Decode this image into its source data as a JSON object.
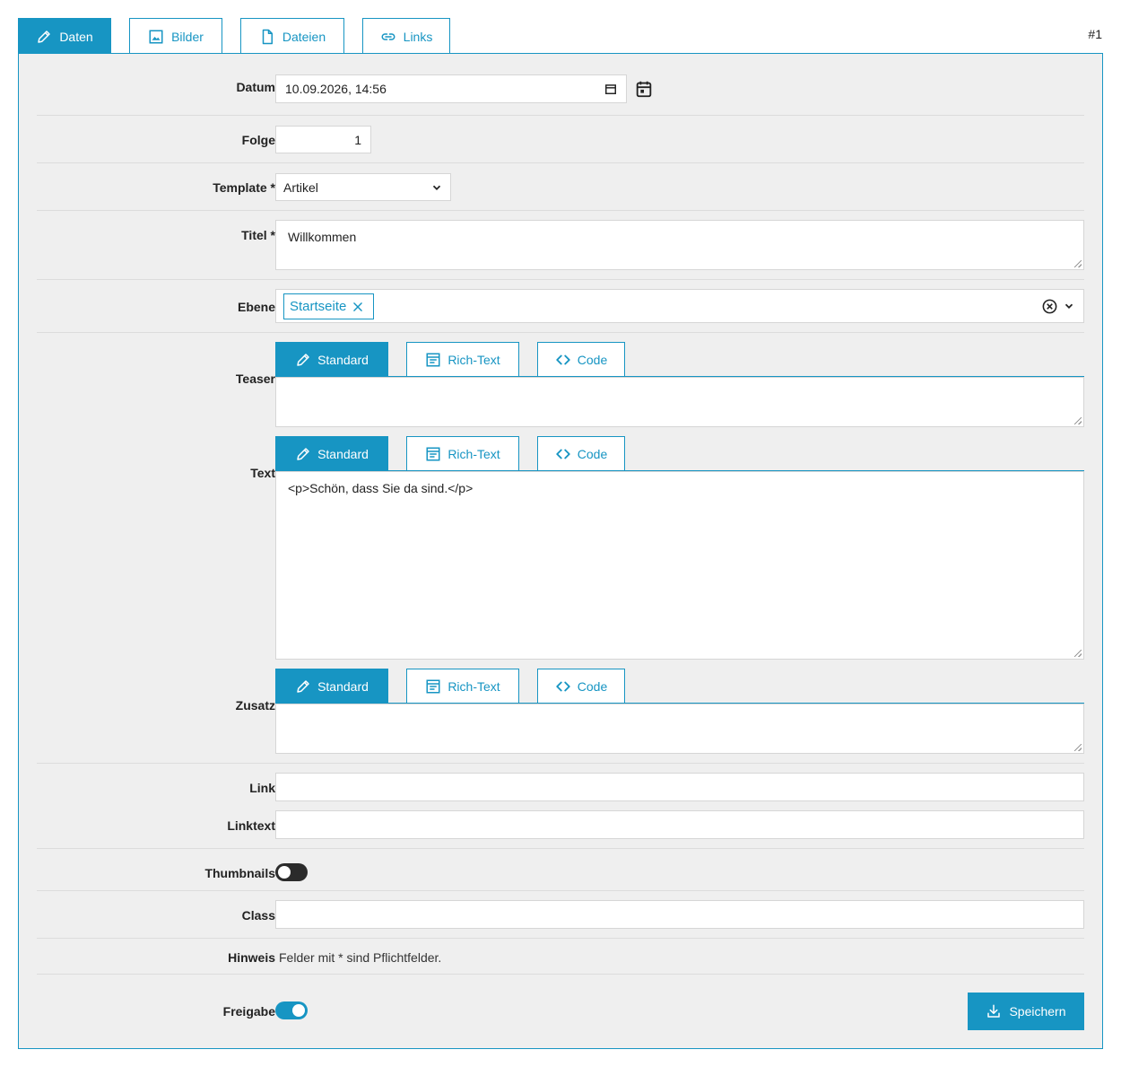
{
  "top_tabs": [
    {
      "label": "Daten",
      "icon": "pencil-icon",
      "active": true
    },
    {
      "label": "Bilder",
      "icon": "image-icon",
      "active": false
    },
    {
      "label": "Dateien",
      "icon": "file-icon",
      "active": false
    },
    {
      "label": "Links",
      "icon": "link-icon",
      "active": false
    }
  ],
  "record_id": "#1",
  "colors": {
    "accent": "#1795c3",
    "panel_bg": "#efefef",
    "toggle_off": "#2b2b2b"
  },
  "form": {
    "datum": {
      "label": "Datum",
      "value": "10.09.2026, 14:56"
    },
    "folge": {
      "label": "Folge",
      "value": "1"
    },
    "template": {
      "label": "Template *",
      "value": "Artikel"
    },
    "titel": {
      "label": "Titel *",
      "value": "Willkommen"
    },
    "ebene": {
      "label": "Ebene",
      "chip": "Startseite"
    },
    "teaser": {
      "label": "Teaser",
      "value": ""
    },
    "text": {
      "label": "Text",
      "value": "<p>Schön, dass Sie da sind.</p>"
    },
    "zusatz": {
      "label": "Zusatz",
      "value": ""
    },
    "link": {
      "label": "Link",
      "value": ""
    },
    "linktext": {
      "label": "Linktext",
      "value": ""
    },
    "thumbnails": {
      "label": "Thumbnails",
      "on": false
    },
    "class": {
      "label": "Class",
      "value": ""
    },
    "hinweis": {
      "label": "Hinweis",
      "text": "Felder mit * sind Pflichtfelder."
    },
    "freigabe": {
      "label": "Freigabe",
      "on": true
    }
  },
  "editor_tabs": [
    {
      "label": "Standard",
      "icon": "pencil-icon",
      "active": true
    },
    {
      "label": "Rich-Text",
      "icon": "richtext-icon",
      "active": false
    },
    {
      "label": "Code",
      "icon": "code-icon",
      "active": false
    }
  ],
  "save_label": "Speichern"
}
